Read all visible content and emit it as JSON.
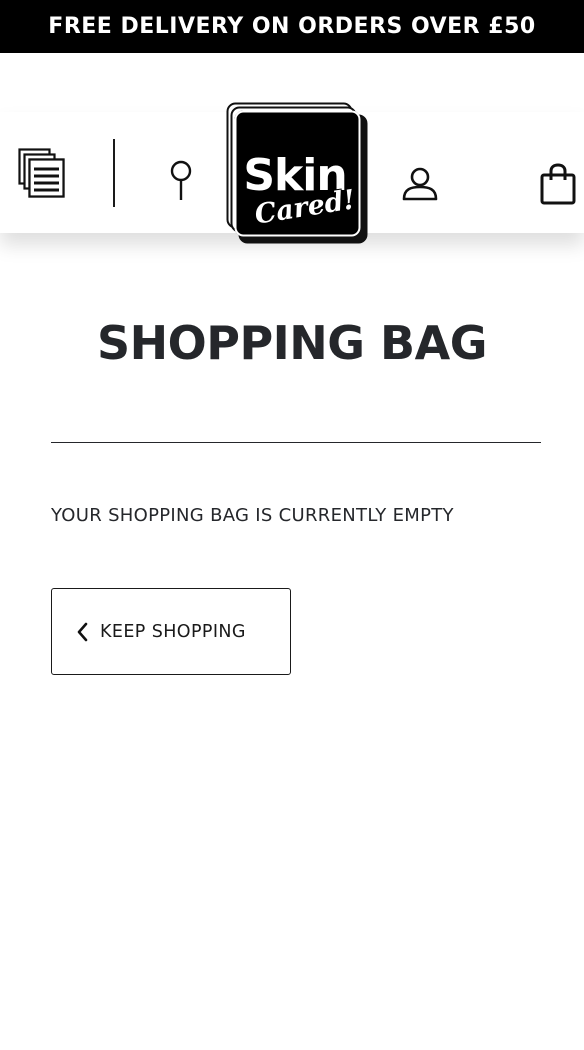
{
  "promo": {
    "text": "FREE DELIVERY ON ORDERS OVER £50"
  },
  "header": {
    "icons": {
      "menu": "menu-icon",
      "search": "search-icon",
      "account": "account-icon",
      "bag": "shopping-bag-icon"
    },
    "logo": {
      "primary": "Skin",
      "script": "Cared!"
    }
  },
  "main": {
    "title": "SHOPPING BAG",
    "empty_message": "YOUR SHOPPING BAG IS CURRENTLY EMPTY",
    "keep_shopping_label": "KEEP SHOPPING"
  },
  "colors": {
    "promo_bg": "#000000",
    "promo_text": "#ffffff",
    "text": "#25272b"
  }
}
